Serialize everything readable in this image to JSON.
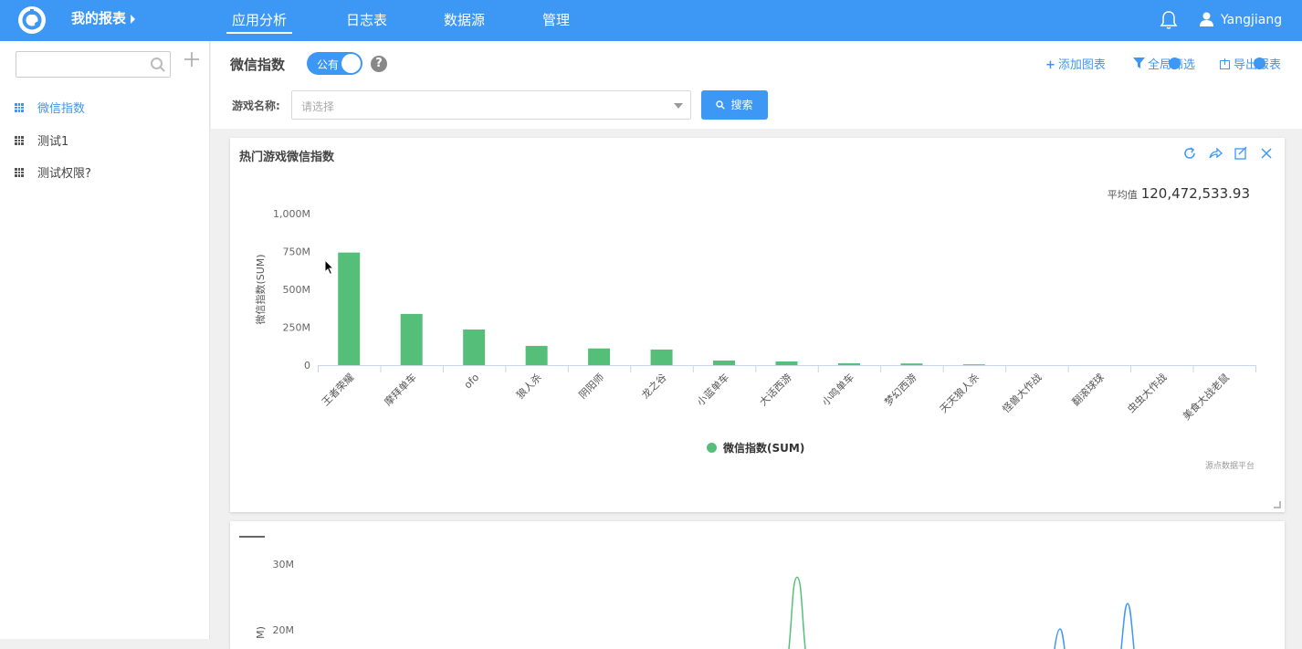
{
  "topbar": {
    "report_menu": "我的报表",
    "nav": [
      "应用分析",
      "日志表",
      "数据源",
      "管理"
    ],
    "user": "Yangjiang"
  },
  "sidebar": {
    "items": [
      {
        "label": "微信指数",
        "active": true
      },
      {
        "label": "测试1",
        "active": false
      },
      {
        "label": "测试权限?",
        "active": false
      }
    ]
  },
  "header": {
    "title": "微信指数",
    "toggle_label": "公有",
    "help": "?",
    "add_chart": "添加图表",
    "global_filter": "全局筛选",
    "export_report": "导出报表"
  },
  "filter": {
    "label": "游戏名称:",
    "placeholder": "请选择",
    "search_label": "搜索"
  },
  "card1": {
    "title": "热门游戏微信指数",
    "avg_label": "平均值",
    "avg_value": "120,472,533.93",
    "source": "源点数据平台"
  },
  "colors": {
    "accent": "#3d97f5",
    "bar": "#55bf7a",
    "line_green": "#55bf7a",
    "line_blue": "#3d97f5"
  },
  "chart_data": [
    {
      "type": "bar",
      "title": "热门游戏微信指数",
      "ylabel": "微信指数(SUM)",
      "xlabel": "",
      "categories": [
        "王者荣耀",
        "摩拜单车",
        "ofo",
        "狼人杀",
        "阴阳师",
        "龙之谷",
        "小蓝单车",
        "大话西游",
        "小鸣单车",
        "梦幻西游",
        "天天狼人杀",
        "怪兽大作战",
        "翻滚球球",
        "虫虫大作战",
        "美食大战老鼠"
      ],
      "series": [
        {
          "name": "微信指数(SUM)",
          "values": [
            743000000,
            338000000,
            235000000,
            127000000,
            110000000,
            103000000,
            30000000,
            24000000,
            12000000,
            11000000,
            5000000,
            0,
            0,
            0,
            0
          ]
        }
      ],
      "ylim": [
        0,
        1000000000
      ],
      "yticks": [
        "0",
        "250M",
        "500M",
        "750M",
        "1,000M"
      ],
      "legend": "bottom",
      "grid": false
    },
    {
      "type": "line",
      "yticks": [
        "20M",
        "30M"
      ],
      "ylabel_partial": "M)",
      "series": [
        {
          "color": "green",
          "peak": 28000000
        },
        {
          "color": "blue",
          "peak": 24000000
        }
      ]
    }
  ]
}
